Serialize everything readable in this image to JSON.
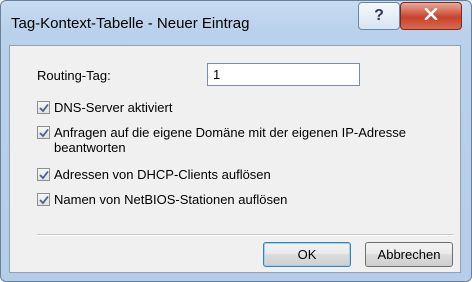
{
  "window": {
    "title": "Tag-Kontext-Tabelle - Neuer Eintrag",
    "help_glyph": "?",
    "close_icon": "close-x-icon"
  },
  "form": {
    "routing_label": "Routing-Tag:",
    "routing_value": "1",
    "checkboxes": [
      {
        "label": "DNS-Server aktiviert",
        "checked": true
      },
      {
        "label": "Anfragen auf die eigene Domäne mit der eigenen IP-Adresse beantworten",
        "checked": true
      },
      {
        "label": "Adressen von DHCP-Clients auflösen",
        "checked": true
      },
      {
        "label": "Namen von NetBIOS-Stationen auflösen",
        "checked": true
      }
    ]
  },
  "buttons": {
    "ok_label": "OK",
    "cancel_label": "Abbrechen"
  }
}
